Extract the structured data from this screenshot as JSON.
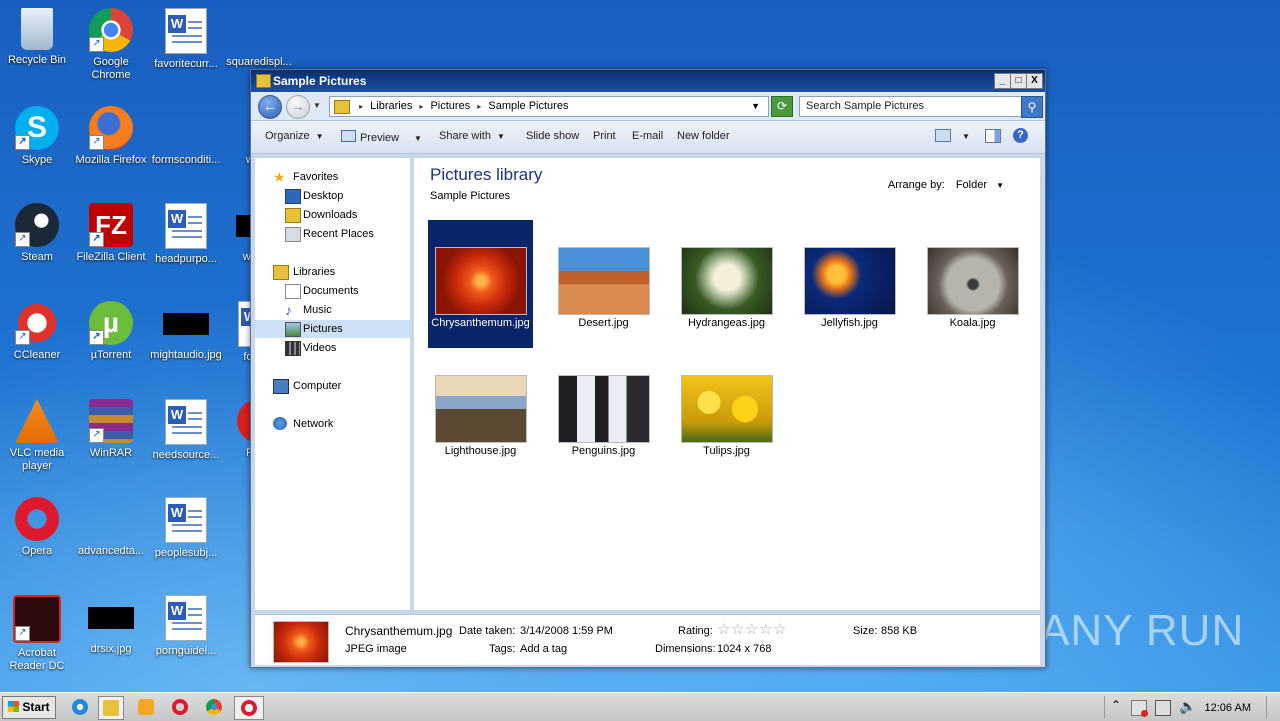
{
  "desktop": {
    "icons": [
      {
        "label": "Recycle Bin"
      },
      {
        "label": "Google Chrome"
      },
      {
        "label": "favoritecurr..."
      },
      {
        "label": "squaredispl..."
      },
      {
        "label": "Skype"
      },
      {
        "label": "Mozilla Firefox"
      },
      {
        "label": "formsconditi..."
      },
      {
        "label": "war..."
      },
      {
        "label": "Steam"
      },
      {
        "label": "FileZilla Client"
      },
      {
        "label": "headpurpo..."
      },
      {
        "label": "what..."
      },
      {
        "label": "CCleaner"
      },
      {
        "label": "µTorrent"
      },
      {
        "label": "mightaudio.jpg"
      },
      {
        "label": "form..."
      },
      {
        "label": "VLC media player"
      },
      {
        "label": "WinRAR"
      },
      {
        "label": "needsource..."
      },
      {
        "label": "RO..."
      },
      {
        "label": "Opera"
      },
      {
        "label": "advancedta..."
      },
      {
        "label": "peoplesubj..."
      },
      {
        "label": "Acrobat Reader DC"
      },
      {
        "label": "drsix.jpg"
      },
      {
        "label": "pornguidel..."
      }
    ],
    "watermark": "ANY RUN"
  },
  "window": {
    "title": "Sample Pictures",
    "controls": {
      "minimize": "_",
      "maximize": "□",
      "close": "X"
    },
    "breadcrumb": [
      "Libraries",
      "Pictures",
      "Sample Pictures"
    ],
    "search_placeholder": "Search Sample Pictures",
    "toolbar": {
      "organize": "Organize",
      "preview": "Preview",
      "share_with": "Share with",
      "slide_show": "Slide show",
      "print": "Print",
      "email": "E-mail",
      "new_folder": "New folder"
    },
    "nav": {
      "favorites": "Favorites",
      "desktop": "Desktop",
      "downloads": "Downloads",
      "recent_places": "Recent Places",
      "libraries": "Libraries",
      "documents": "Documents",
      "music": "Music",
      "pictures": "Pictures",
      "videos": "Videos",
      "computer": "Computer",
      "network": "Network"
    },
    "library": {
      "title": "Pictures library",
      "subtitle": "Sample Pictures",
      "arrange_by_label": "Arrange by:",
      "arrange_by_value": "Folder"
    },
    "files": [
      {
        "name": "Chrysanthemum.jpg",
        "selected": true
      },
      {
        "name": "Desert.jpg"
      },
      {
        "name": "Hydrangeas.jpg"
      },
      {
        "name": "Jellyfish.jpg"
      },
      {
        "name": "Koala.jpg"
      },
      {
        "name": "Lighthouse.jpg"
      },
      {
        "name": "Penguins.jpg"
      },
      {
        "name": "Tulips.jpg"
      }
    ],
    "details": {
      "filename": "Chrysanthemum.jpg",
      "type": "JPEG image",
      "date_taken_label": "Date taken:",
      "date_taken": "3/14/2008 1:59 PM",
      "tags_label": "Tags:",
      "tags": "Add a tag",
      "rating_label": "Rating:",
      "rating": 0,
      "dimensions_label": "Dimensions:",
      "dimensions": "1024 x 768",
      "size_label": "Size:",
      "size": "858 KB"
    }
  },
  "taskbar": {
    "start": "Start",
    "clock": "12:06 AM"
  }
}
